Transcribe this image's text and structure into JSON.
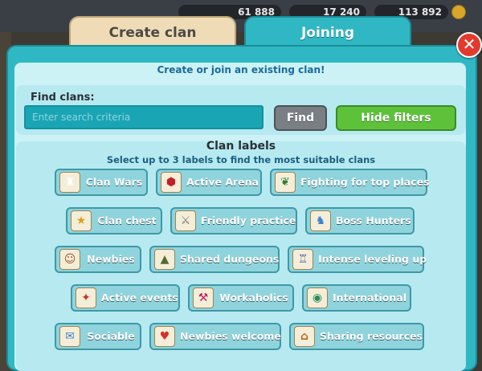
{
  "resources": {
    "r1": "61 888",
    "r2": "17 240",
    "r3": "113 892"
  },
  "tabs": {
    "create": "Create clan",
    "joining": "Joining"
  },
  "subtitle": "Create or join an existing clan!",
  "find": {
    "label": "Find clans:",
    "placeholder": "Enter search criteria",
    "find_button": "Find",
    "hide_filters_button": "Hide filters"
  },
  "labels_section": {
    "title": "Clan labels",
    "subtitle": "Select up to 3 labels to find the most suitable clans",
    "chips": [
      {
        "label": "Clan Wars",
        "icon": "tower-icon"
      },
      {
        "label": "Active Arena",
        "icon": "arena-shield-icon"
      },
      {
        "label": "Fighting for top places",
        "icon": "laurel-wreath-icon"
      },
      {
        "label": "Clan chest",
        "icon": "star-badge-icon"
      },
      {
        "label": "Friendly practice",
        "icon": "crossed-swords-icon"
      },
      {
        "label": "Boss Hunters",
        "icon": "boss-icon"
      },
      {
        "label": "Newbies",
        "icon": "newbie-icon"
      },
      {
        "label": "Shared dungeons",
        "icon": "cave-icon"
      },
      {
        "label": "Intense leveling up",
        "icon": "castle-icon"
      },
      {
        "label": "Active events",
        "icon": "event-icon"
      },
      {
        "label": "Workaholics",
        "icon": "tools-icon"
      },
      {
        "label": "International",
        "icon": "globe-icon"
      },
      {
        "label": "Sociable",
        "icon": "speech-bubble-icon"
      },
      {
        "label": "Newbies welcome",
        "icon": "heart-icon"
      },
      {
        "label": "Sharing resources",
        "icon": "house-icon"
      }
    ]
  },
  "colors": {
    "accent": "#2fb8c4",
    "find_button": "#7a7f84",
    "hide_filters_button": "#5dc23a",
    "close_button": "#e23a2e"
  }
}
